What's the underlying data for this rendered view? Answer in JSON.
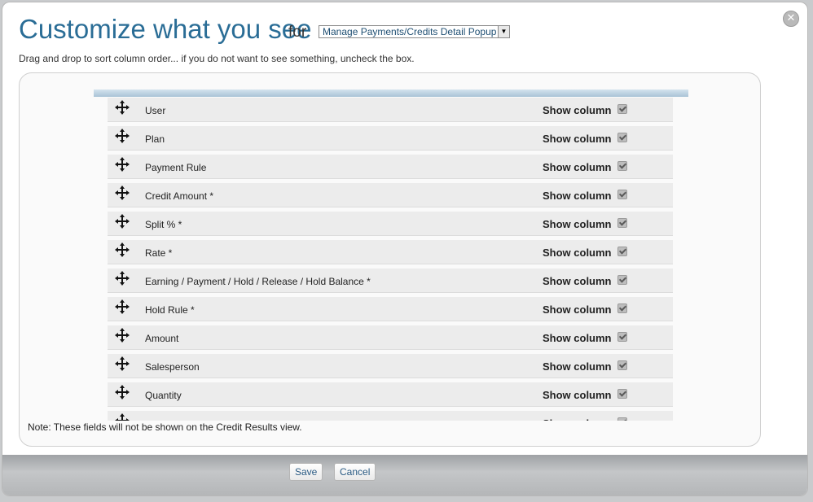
{
  "dialog": {
    "title": "Customize what you see",
    "for_label": "for",
    "view_select": {
      "selected": "Manage Payments/Credits Detail Popup"
    },
    "instructions": "Drag and drop to sort column order... if you do not want to see something, uncheck the box.",
    "note": "Note: These fields will not be shown on the Credit Results view.",
    "close_icon": "close-icon",
    "drag_icon": "move-arrows-icon",
    "accent_color": "#2a6d96"
  },
  "columns": [
    {
      "name": "User",
      "show_label": "Show column",
      "checked": true
    },
    {
      "name": "Plan",
      "show_label": "Show column",
      "checked": true
    },
    {
      "name": "Payment Rule",
      "show_label": "Show column",
      "checked": true
    },
    {
      "name": "Credit Amount *",
      "show_label": "Show column",
      "checked": true
    },
    {
      "name": "Split % *",
      "show_label": "Show column",
      "checked": true
    },
    {
      "name": "Rate *",
      "show_label": "Show column",
      "checked": true
    },
    {
      "name": "Earning / Payment / Hold / Release / Hold Balance *",
      "show_label": "Show column",
      "checked": true
    },
    {
      "name": "Hold Rule *",
      "show_label": "Show column",
      "checked": true
    },
    {
      "name": "Amount",
      "show_label": "Show column",
      "checked": true
    },
    {
      "name": "Salesperson",
      "show_label": "Show column",
      "checked": true
    },
    {
      "name": "Quantity",
      "show_label": "Show column",
      "checked": true
    },
    {
      "name": "",
      "show_label": "Show column",
      "checked": true
    }
  ],
  "footer": {
    "save_label": "Save",
    "cancel_label": "Cancel"
  }
}
